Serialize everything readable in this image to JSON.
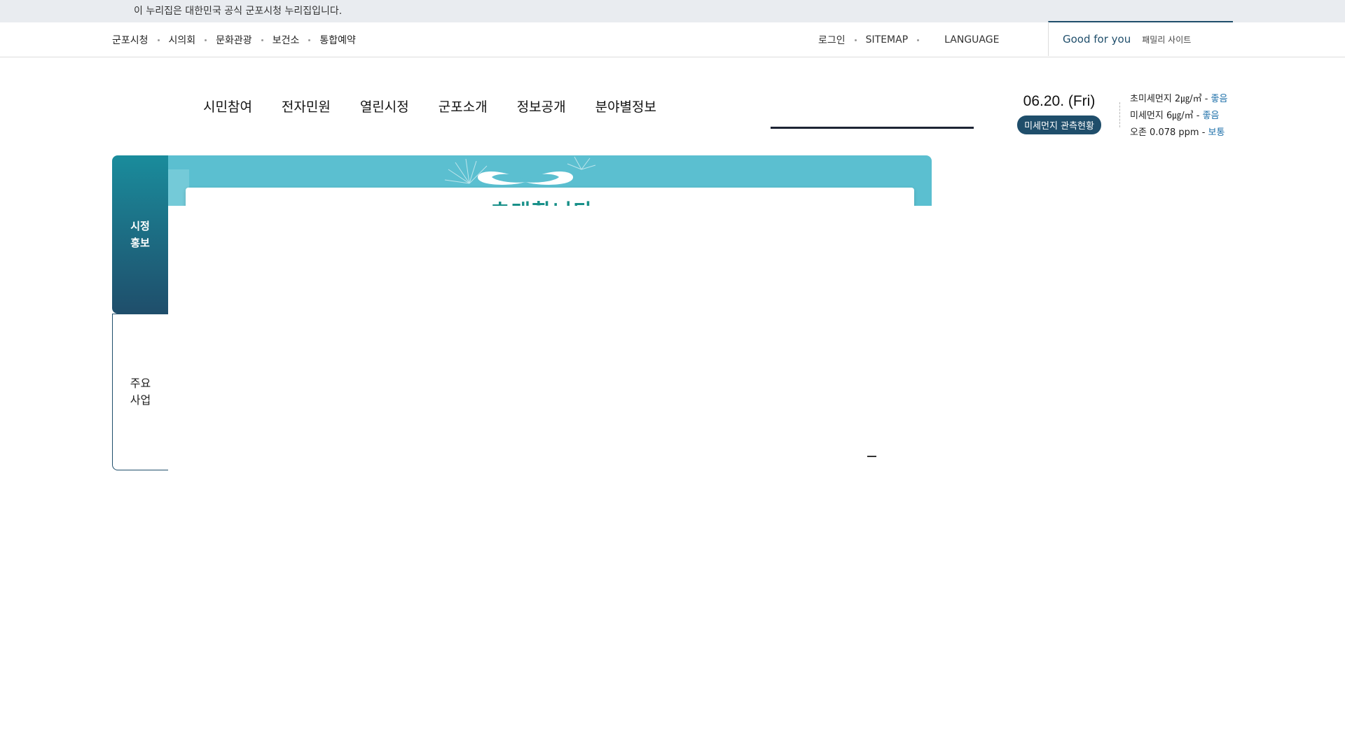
{
  "gov_banner": {
    "text": "이 누리집은 대한민국 공식 군포시청 누리집입니다."
  },
  "util_left": [
    {
      "label": "군포시청"
    },
    {
      "label": "시의회"
    },
    {
      "label": "문화관광"
    },
    {
      "label": "보건소"
    },
    {
      "label": "통합예약"
    }
  ],
  "util_right": {
    "login": "로그인",
    "sitemap": "SITEMAP",
    "language": "LANGUAGE",
    "good_for_you": "Good for you",
    "family_site": "패밀리 사이트"
  },
  "gnb": [
    {
      "label": "시민참여"
    },
    {
      "label": "전자민원"
    },
    {
      "label": "열린시정"
    },
    {
      "label": "군포소개"
    },
    {
      "label": "정보공개"
    },
    {
      "label": "분야별정보"
    }
  ],
  "weather": {
    "date": "06.20. (Fri)",
    "dust_button": "미세먼지 관측현황",
    "ultrafine": {
      "label": "초미세먼지 2㎍/㎥ - ",
      "status": "좋음"
    },
    "fine": {
      "label": "미세먼지 6㎍/㎥ - ",
      "status": "좋음"
    },
    "ozone": {
      "label": "오존 0.078 ppm - ",
      "status": "보통"
    }
  },
  "tabs": {
    "active_line1": "시정",
    "active_line2": "홍보",
    "inactive_line1": "주요",
    "inactive_line2": "사업"
  },
  "banner": {
    "title_peek": "초대합니다"
  },
  "colors": {
    "primary": "#1f4e6b",
    "banner_bg": "#5bbfd0",
    "status_good": "#1b6ea8",
    "gov_banner_bg": "#e9ecf0"
  }
}
